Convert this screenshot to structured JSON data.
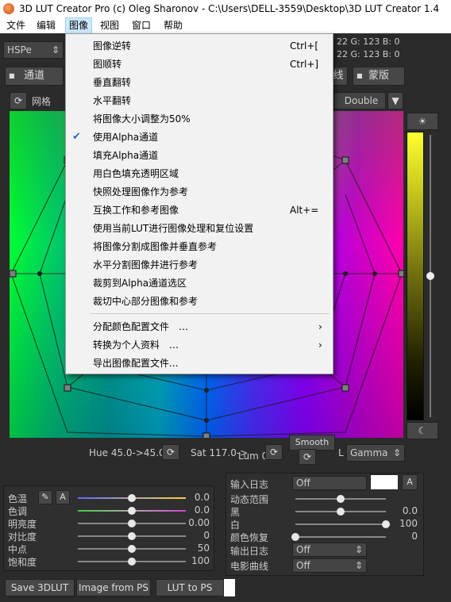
{
  "window": {
    "title": "3D LUT Creator Pro (c) Oleg Sharonov - C:\\Users\\DELL-3559\\Desktop\\3D LUT Creator 1.4"
  },
  "menubar": {
    "items": [
      "文件",
      "编辑",
      "图像",
      "视图",
      "窗口",
      "帮助"
    ]
  },
  "toolbar": {
    "mode_select": "HSPe",
    "tab_channel": "通道",
    "tab_curve": "线",
    "tab_mask": "蒙版",
    "grid_label": "网格",
    "precision_select": "Double",
    "info_line1": "22  G: 123  B:  0",
    "info_line2": "22  G: 123  B:  0"
  },
  "image_menu": {
    "items": [
      {
        "label": "图像逆转",
        "shortcut": "Ctrl+["
      },
      {
        "label": "图顺转",
        "shortcut": "Ctrl+]"
      },
      {
        "label": "垂直翻转",
        "shortcut": ""
      },
      {
        "label": "水平翻转",
        "shortcut": ""
      },
      {
        "label": "将图像大小调整为50%",
        "shortcut": ""
      },
      {
        "label": "使用Alpha通道",
        "shortcut": "",
        "checked": true
      },
      {
        "label": "填充Alpha通道",
        "shortcut": ""
      },
      {
        "label": "用白色填充透明区域",
        "shortcut": ""
      },
      {
        "label": "快照处理图像作为参考",
        "shortcut": ""
      },
      {
        "label": "互换工作和参考图像",
        "shortcut": "Alt+="
      },
      {
        "label": "使用当前LUT进行图像处理和复位设置",
        "shortcut": ""
      },
      {
        "label": "将图像分割成图像并垂直参考",
        "shortcut": ""
      },
      {
        "label": "水平分割图像并进行参考",
        "shortcut": ""
      },
      {
        "label": "裁剪到Alpha通道选区",
        "shortcut": ""
      },
      {
        "label": "裁切中心部分图像和参考",
        "shortcut": ""
      },
      {
        "label": "分配颜色配置文件　…",
        "shortcut": "",
        "submenu": true
      },
      {
        "label": "转换为个人资料　…",
        "shortcut": "",
        "submenu": true
      },
      {
        "label": "导出图像配置文件...",
        "shortcut": ""
      }
    ]
  },
  "status": {
    "hue": "Hue 45.0->45.0",
    "sat": "Sat 117.0->",
    "lum": "Lum 0",
    "smooth": "Smooth",
    "l_label": "L",
    "gamma": "Gamma"
  },
  "left_panel": {
    "a_button": "A",
    "sliders": [
      {
        "label": "色温",
        "value": "0.0",
        "level": 0.5
      },
      {
        "label": "色调",
        "value": "0.0",
        "level": 0.5
      },
      {
        "label": "明亮度",
        "value": "0.00",
        "level": 0.5
      },
      {
        "label": "对比度",
        "value": "0",
        "level": 0.5
      },
      {
        "label": "中点",
        "value": "50",
        "level": 0.5
      },
      {
        "label": "饱和度",
        "value": "100",
        "level": 0.5
      }
    ]
  },
  "right_panel": {
    "input_log_label": "输入日志",
    "input_log_value": "Off",
    "a_button": "A",
    "sliders": [
      {
        "label": "动态范围",
        "value": "",
        "level": 0.5
      },
      {
        "label": "黑",
        "value": "0.0",
        "level": 0.5
      },
      {
        "label": "白",
        "value": "100",
        "level": 1.0
      },
      {
        "label": "颜色恢复",
        "value": "0",
        "level": 0.0
      }
    ],
    "output_log_label": "输出日志",
    "output_log_value": "Off",
    "film_curve_label": "电影曲线",
    "film_curve_value": "Off"
  },
  "bottom_buttons": {
    "save": "Save 3DLUT",
    "image_from_ps": "Image from PS",
    "lut_to_ps": "LUT to PS"
  },
  "colors": {
    "menu_highlight": "#cce8ff",
    "check_mark": "#1f6fbf",
    "panel_bg": "#2b2b2b"
  }
}
